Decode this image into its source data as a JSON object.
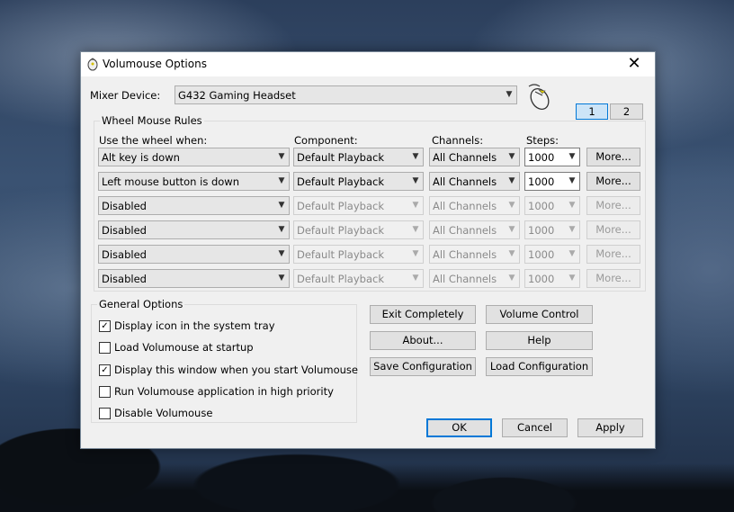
{
  "window": {
    "title": "Volumouse Options",
    "close_glyph": "✕"
  },
  "mixer": {
    "label": "Mixer Device:",
    "value": "G432 Gaming Headset"
  },
  "tabs": [
    "1",
    "2"
  ],
  "wheel_rules": {
    "group_title": "Wheel Mouse Rules",
    "headers": {
      "when": "Use the wheel when:",
      "component": "Component:",
      "channels": "Channels:",
      "steps": "Steps:"
    },
    "rows": [
      {
        "when": "Alt key is down",
        "component": "Default Playback",
        "channels": "All Channels",
        "steps": "1000",
        "more": "More...",
        "enabled": true
      },
      {
        "when": "Left mouse button is down",
        "component": "Default Playback",
        "channels": "All Channels",
        "steps": "1000",
        "more": "More...",
        "enabled": true
      },
      {
        "when": "Disabled",
        "component": "Default Playback",
        "channels": "All Channels",
        "steps": "1000",
        "more": "More...",
        "enabled": false
      },
      {
        "when": "Disabled",
        "component": "Default Playback",
        "channels": "All Channels",
        "steps": "1000",
        "more": "More...",
        "enabled": false
      },
      {
        "when": "Disabled",
        "component": "Default Playback",
        "channels": "All Channels",
        "steps": "1000",
        "more": "More...",
        "enabled": false
      },
      {
        "when": "Disabled",
        "component": "Default Playback",
        "channels": "All Channels",
        "steps": "1000",
        "more": "More...",
        "enabled": false
      }
    ]
  },
  "general": {
    "group_title": "General Options",
    "options": [
      {
        "label": "Display icon in the system tray",
        "checked": true
      },
      {
        "label": "Load Volumouse at startup",
        "checked": false
      },
      {
        "label": "Display this window when you start Volumouse",
        "checked": true
      },
      {
        "label": "Run Volumouse application in high priority",
        "checked": false
      },
      {
        "label": "Disable Volumouse",
        "checked": false
      }
    ]
  },
  "actions": {
    "exit": "Exit Completely",
    "volume_control": "Volume Control",
    "about": "About...",
    "help": "Help",
    "save_config": "Save Configuration",
    "load_config": "Load Configuration"
  },
  "footer": {
    "ok": "OK",
    "cancel": "Cancel",
    "apply": "Apply"
  },
  "colors": {
    "accent": "#0078d7",
    "window_bg": "#f0f0f0"
  }
}
